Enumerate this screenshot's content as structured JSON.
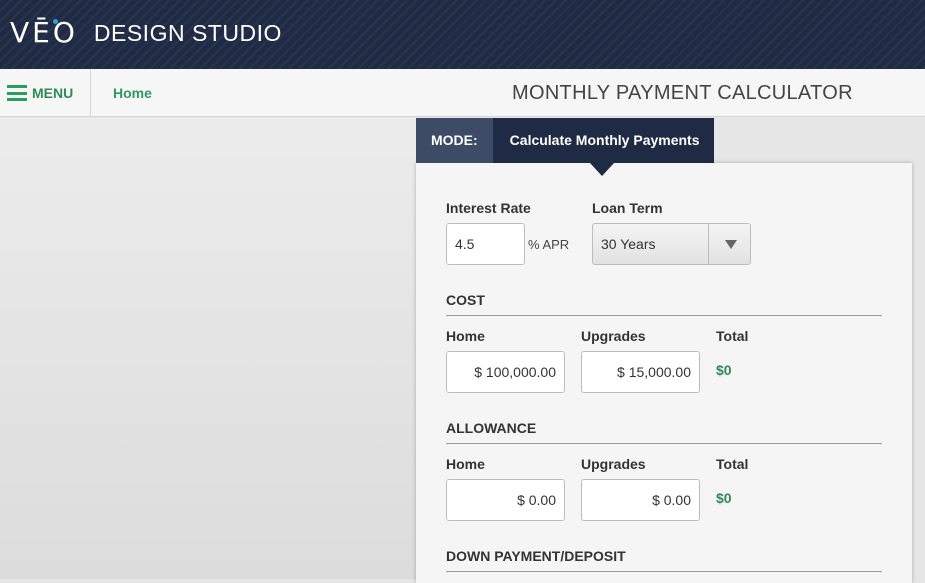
{
  "header": {
    "logo_mark": "VĒO",
    "logo_subtitle": "DESIGN STUDIO"
  },
  "nav": {
    "menu_label": "MENU",
    "breadcrumb": "Home",
    "page_title": "MONTHLY PAYMENT CALCULATOR"
  },
  "mode": {
    "label": "MODE:",
    "value": "Calculate Monthly Payments"
  },
  "rate": {
    "label": "Interest Rate",
    "value": "4.5",
    "unit": "% APR"
  },
  "term": {
    "label": "Loan Term",
    "value": "30 Years"
  },
  "cost": {
    "heading": "COST",
    "home_label": "Home",
    "home_value": "$ 100,000.00",
    "upgrades_label": "Upgrades",
    "upgrades_value": "$ 15,000.00",
    "total_label": "Total",
    "total_value": "$0"
  },
  "allowance": {
    "heading": "ALLOWANCE",
    "home_label": "Home",
    "home_value": "$ 0.00",
    "upgrades_label": "Upgrades",
    "upgrades_value": "$ 0.00",
    "total_label": "Total",
    "total_value": "$0"
  },
  "down_payment": {
    "heading": "DOWN PAYMENT/DEPOSIT"
  },
  "colors": {
    "header_bg": "#1f2a44",
    "accent_green": "#2e8b57",
    "logo_dot": "#21a8e0"
  }
}
